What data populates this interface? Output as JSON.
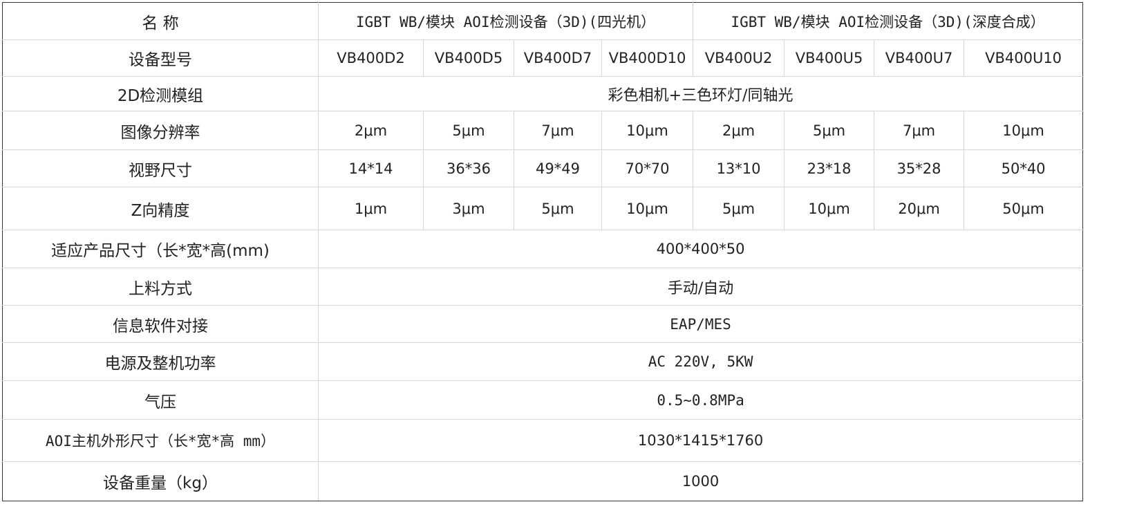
{
  "table": {
    "header": {
      "label": "名 称",
      "group_3d_four_light": "IGBT WB/模块 AOI检测设备（3D)(四光机）",
      "group_3d_depth": "IGBT WB/模块 AOI检测设备（3D)(深度合成）"
    },
    "model": {
      "label": "设备型号",
      "values": [
        "VB400D2",
        "VB400D5",
        "VB400D7",
        "VB400D10",
        "VB400U2",
        "VB400U5",
        "VB400U7",
        "VB400U10"
      ]
    },
    "module_2d": {
      "label": "2D检测模组",
      "value": "彩色相机+三色环灯/同轴光"
    },
    "resolution": {
      "label": "图像分辨率",
      "values": [
        "2μm",
        "5μm",
        "7μm",
        "10μm",
        "2μm",
        "5μm",
        "7μm",
        "10μm"
      ]
    },
    "fov": {
      "label": "视野尺寸",
      "values": [
        "14*14",
        "36*36",
        "49*49",
        "70*70",
        "13*10",
        "23*18",
        "35*28",
        "50*40"
      ]
    },
    "z_accuracy": {
      "label": "Z向精度",
      "values": [
        "1μm",
        "3μm",
        "5μm",
        "10μm",
        "5μm",
        "10μm",
        "20μm",
        "50μm"
      ]
    },
    "product_size": {
      "label": "适应产品尺寸（长*宽*高(mm)",
      "value": "400*400*50"
    },
    "loading": {
      "label": "上料方式",
      "value": "手动/自动"
    },
    "software": {
      "label": "信息软件对接",
      "value": "EAP/MES"
    },
    "power": {
      "label": "电源及整机功率",
      "value": "AC 220V, 5KW"
    },
    "air_pressure": {
      "label": "气压",
      "value": "0.5~0.8MPa"
    },
    "machine_size": {
      "label": "AOI主机外形尺寸（长*宽*高 mm）",
      "value": "1030*1415*1760"
    },
    "weight": {
      "label": "设备重量（kg）",
      "value": "1000"
    }
  }
}
